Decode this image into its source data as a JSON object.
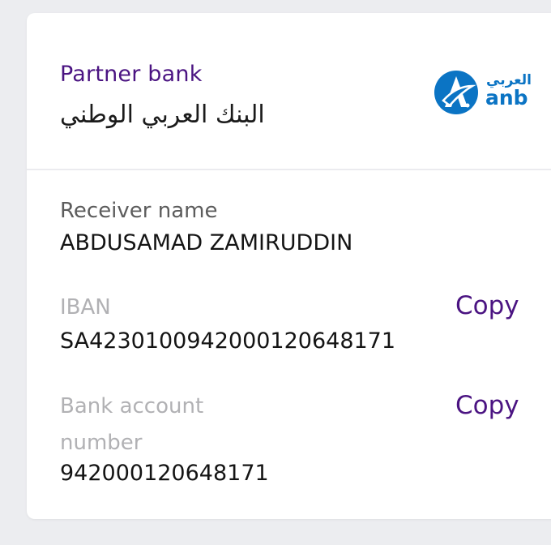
{
  "partner": {
    "label": "Partner bank",
    "bank_name": "البنك العربي الوطني",
    "logo": {
      "arabic_text": "العربي",
      "latin_text": "anb",
      "brand_color": "#0b74c4"
    }
  },
  "receiver": {
    "label": "Receiver name",
    "value": "ABDUSAMAD ZAMIRUDDIN"
  },
  "iban": {
    "label": "IBAN",
    "value": "SA4230100942000120648171",
    "copy_label": "Copy"
  },
  "account": {
    "label_line1": "Bank account",
    "label_line2": "number",
    "value": "942000120648171",
    "copy_label": "Copy"
  },
  "colors": {
    "accent": "#4b1482",
    "background": "#ecedf0",
    "card": "#ffffff"
  }
}
